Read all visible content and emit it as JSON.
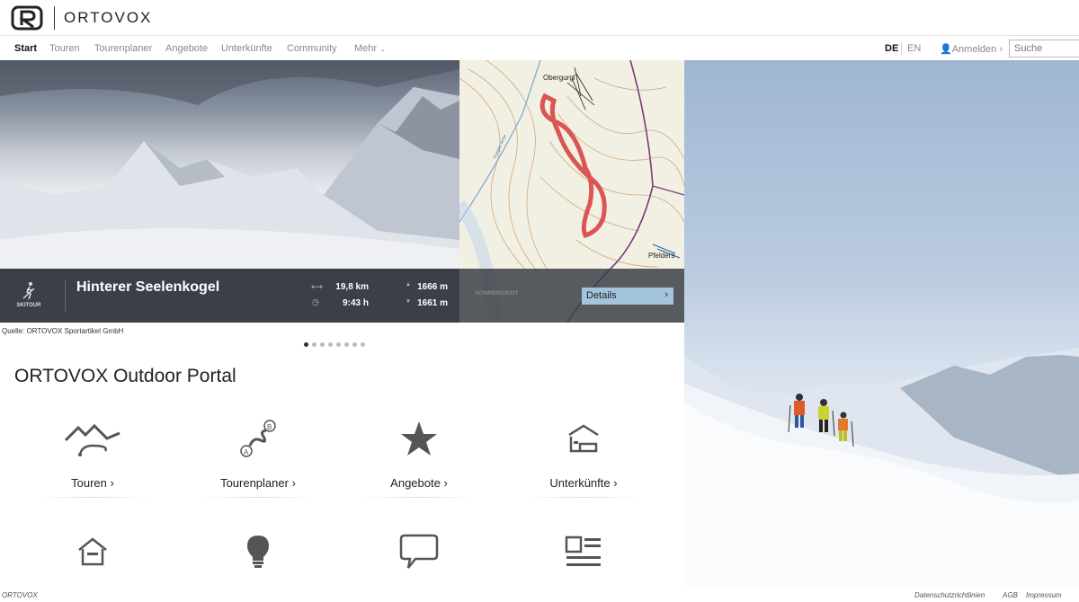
{
  "brand": {
    "name": "ORTOVOX"
  },
  "nav": {
    "items": [
      "Start",
      "Touren",
      "Tourenplaner",
      "Angebote",
      "Unterkünfte",
      "Community",
      "Mehr"
    ],
    "lang_de": "DE",
    "lang_en": "EN",
    "login": "Anmelden",
    "search_placeholder": "Suche"
  },
  "hero": {
    "badge": "SKITOUR",
    "tour_name": "Hinterer Seelenkogel",
    "distance": "19,8 km",
    "duration": "9:43 h",
    "ascent": "1666 m",
    "descent": "1661 m",
    "difficulty_label": "SCHWIERIGKEIT",
    "details_label": "Details",
    "map_places": [
      "Obergurgl",
      "Pfelders"
    ],
    "map_river": "Gurgler Ache",
    "caption": "Quelle: ORTOVOX Sportartikel GmbH",
    "slides": 8,
    "active_slide": 1
  },
  "portal": {
    "title": "ORTOVOX Outdoor Portal",
    "tiles": [
      {
        "label": "Touren",
        "icon": "mountain-route-icon"
      },
      {
        "label": "Tourenplaner",
        "icon": "route-planner-icon"
      },
      {
        "label": "Angebote",
        "icon": "star-icon"
      },
      {
        "label": "Unterkünfte",
        "icon": "bed-icon"
      },
      {
        "label": "",
        "icon": "house-icon"
      },
      {
        "label": "",
        "icon": "lightbulb-icon"
      },
      {
        "label": "",
        "icon": "speech-bubble-icon"
      },
      {
        "label": "",
        "icon": "news-icon"
      }
    ]
  },
  "footer": {
    "brand": "ORTOVOX",
    "privacy": "Datenschutzrichtlinien",
    "agb": "AGB",
    "impressum": "Impressum"
  }
}
